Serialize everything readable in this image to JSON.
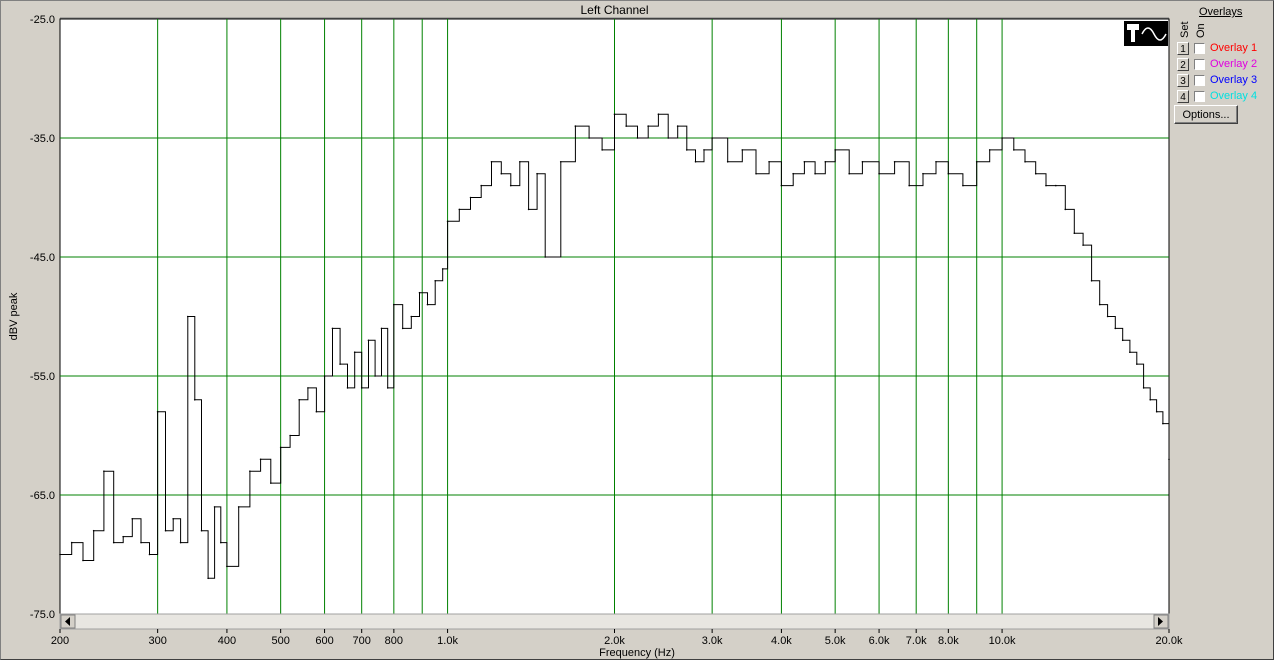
{
  "window": {
    "title": "Left Channel"
  },
  "overlays": {
    "title": "Overlays",
    "set_label": "Set",
    "on_label": "On",
    "items": [
      {
        "num": "1",
        "label": "Overlay 1",
        "color": "#ff0000",
        "checked": false
      },
      {
        "num": "2",
        "label": "Overlay 2",
        "color": "#e000e0",
        "checked": false
      },
      {
        "num": "3",
        "label": "Overlay 3",
        "color": "#0000ff",
        "checked": false
      },
      {
        "num": "4",
        "label": "Overlay 4",
        "color": "#00e0e0",
        "checked": false
      }
    ],
    "options_label": "Options..."
  },
  "mode_icon": "sine-wave-icon",
  "chart_data": {
    "type": "line",
    "title": "Left Channel",
    "xlabel": "Frequency (Hz)",
    "ylabel": "dBV peak",
    "xscale": "log",
    "xlim": [
      200,
      20000
    ],
    "ylim": [
      -75,
      -25
    ],
    "yticks": [
      -25,
      -35,
      -45,
      -55,
      -65,
      -75
    ],
    "ytick_labels": [
      "-25.0",
      "-35.0",
      "-45.0",
      "-55.0",
      "-65.0",
      "-75.0"
    ],
    "xticks": [
      200,
      300,
      400,
      500,
      600,
      700,
      800,
      1000,
      2000,
      3000,
      4000,
      5000,
      6000,
      7000,
      8000,
      10000,
      20000
    ],
    "xtick_labels": [
      "200",
      "300",
      "400",
      "500",
      "600",
      "700",
      "800",
      "1.0k",
      "2.0k",
      "3.0k",
      "4.0k",
      "5.0k",
      "6.0k",
      "7.0k",
      "8.0k",
      "10.0k",
      "20.0k"
    ],
    "grid_x": [
      300,
      400,
      500,
      600,
      700,
      800,
      900,
      1000,
      2000,
      3000,
      4000,
      5000,
      6000,
      7000,
      8000,
      9000,
      10000
    ],
    "grid": true,
    "colors": {
      "plot_bg": "#ffffff",
      "grid": "#008000",
      "trace": "#000000"
    },
    "series": [
      {
        "x": [
          200,
          210,
          220,
          230,
          240,
          250,
          260,
          270,
          280,
          290,
          300,
          310,
          320,
          330,
          340,
          350,
          360,
          370,
          380,
          390,
          400,
          420,
          440,
          460,
          480,
          500,
          520,
          540,
          560,
          580,
          600,
          620,
          640,
          660,
          680,
          700,
          720,
          740,
          760,
          780,
          800,
          830,
          860,
          890,
          920,
          950,
          980,
          1000,
          1050,
          1100,
          1150,
          1200,
          1250,
          1300,
          1350,
          1400,
          1450,
          1500,
          1600,
          1700,
          1800,
          1900,
          2000,
          2100,
          2200,
          2300,
          2400,
          2500,
          2600,
          2700,
          2800,
          2900,
          3000,
          3200,
          3400,
          3600,
          3800,
          4000,
          4200,
          4400,
          4600,
          4800,
          5000,
          5300,
          5600,
          6000,
          6400,
          6800,
          7200,
          7600,
          8000,
          8500,
          9000,
          9500,
          10000,
          10500,
          11000,
          11500,
          12000,
          12500,
          13000,
          13500,
          14000,
          14500,
          15000,
          15500,
          16000,
          16500,
          17000,
          17500,
          18000,
          18500,
          19000,
          19500,
          20000
        ],
        "y": [
          -70,
          -69,
          -70.5,
          -68,
          -63,
          -69,
          -68.5,
          -67,
          -69,
          -70,
          -58,
          -68,
          -67,
          -69,
          -50,
          -57,
          -68,
          -72,
          -66,
          -69,
          -71,
          -66,
          -63,
          -62,
          -64,
          -61,
          -60,
          -57,
          -56,
          -58,
          -55,
          -51,
          -54,
          -56,
          -53,
          -56,
          -52,
          -55,
          -51,
          -56,
          -49,
          -51,
          -50,
          -48,
          -49,
          -47,
          -46,
          -42,
          -41,
          -40,
          -39,
          -37,
          -38,
          -39,
          -37,
          -41,
          -38,
          -45,
          -37,
          -34,
          -35,
          -36,
          -33,
          -34,
          -35,
          -34,
          -33,
          -35,
          -34,
          -36,
          -37,
          -36,
          -35,
          -37,
          -36,
          -38,
          -37,
          -39,
          -38,
          -37,
          -38,
          -37,
          -36,
          -38,
          -37,
          -38,
          -37,
          -39,
          -38,
          -37,
          -38,
          -39,
          -37,
          -36,
          -35,
          -36,
          -37,
          -38,
          -39,
          -39,
          -41,
          -43,
          -44,
          -47,
          -49,
          -50,
          -51,
          -52,
          -53,
          -54,
          -56,
          -57,
          -58,
          -59,
          -62
        ]
      }
    ]
  }
}
